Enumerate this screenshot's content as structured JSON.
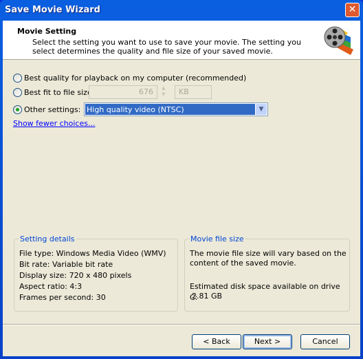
{
  "window": {
    "title": "Save Movie Wizard",
    "close_icon": "close-icon"
  },
  "header": {
    "title": "Movie Setting",
    "description": "Select the setting you want to use to save your movie. The setting you select determines the quality and file size of your saved movie.",
    "icon": "movie-film-reel-icon"
  },
  "options": {
    "best_quality": {
      "label": "Best quality for playback on my computer (recommended)",
      "selected": false
    },
    "best_fit": {
      "label": "Best fit to file size:",
      "selected": false,
      "size_value": "676",
      "unit": "KB"
    },
    "other": {
      "label": "Other settings:",
      "selected": true,
      "value": "High quality video (NTSC)"
    }
  },
  "show_fewer_link": "Show fewer choices...",
  "setting_details": {
    "legend": "Setting details",
    "lines": [
      "File type: Windows Media Video (WMV)",
      "Bit rate: Variable bit rate",
      "Display size: 720 x 480 pixels",
      "Aspect ratio: 4:3",
      "Frames per second: 30"
    ]
  },
  "file_size": {
    "legend": "Movie file size",
    "text1": "The movie file size will vary based on the",
    "text2": "content of the saved movie.",
    "disk_label": "Estimated disk space available on drive C:",
    "disk_value": "2.81 GB"
  },
  "buttons": {
    "back": "< Back",
    "next": "Next >",
    "cancel": "Cancel"
  }
}
